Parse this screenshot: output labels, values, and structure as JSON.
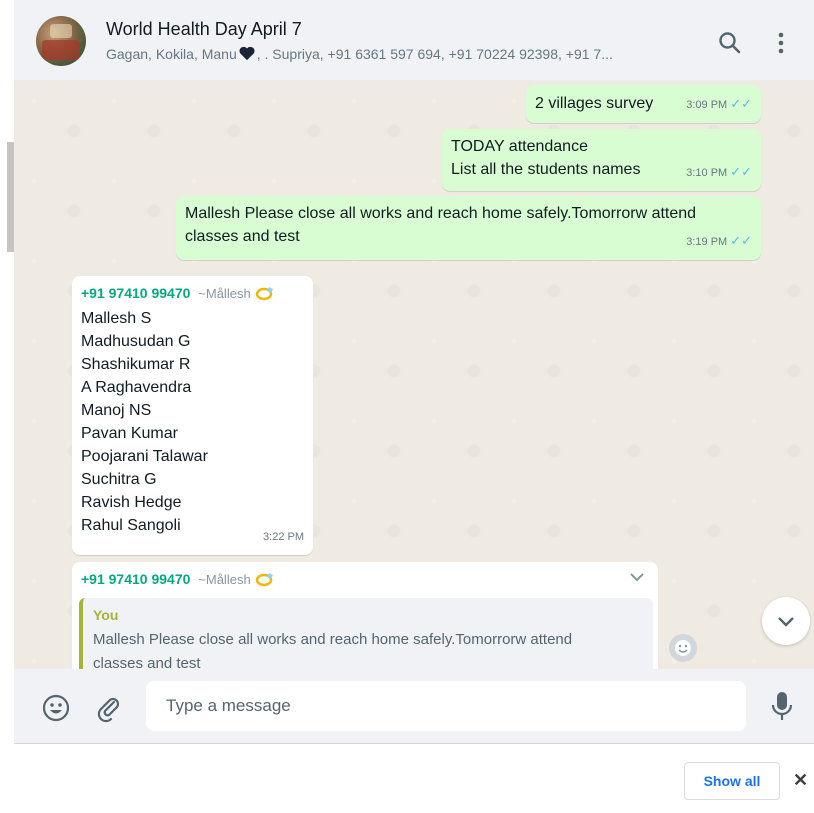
{
  "header": {
    "title": "World Health Day April 7",
    "members_before": "Gagan, Kokila, Manu",
    "members_after": ", . Supriya, +91 6361 597 694, +91 70224 92398, +91 7..."
  },
  "messages": [
    {
      "text": "2 villages survey",
      "time": "3:09 PM"
    },
    {
      "lines": [
        "TODAY attendance",
        "List all the students names"
      ],
      "time": "3:10 PM"
    },
    {
      "lines": [
        "Mallesh Please close all works and reach home safely.Tomorrorw attend",
        "classes and test"
      ],
      "time": "3:19 PM"
    },
    {
      "sender": "+91 97410 99470",
      "alias": "~Mållesh",
      "names": [
        "Mallesh S",
        "Madhusudan G",
        "Shashikumar R",
        "A Raghavendra",
        "Manoj NS",
        "Pavan Kumar",
        "Poojarani Talawar",
        "Suchitra G",
        "Ravish Hedge",
        "Rahul Sangoli"
      ],
      "time": "3:22 PM"
    },
    {
      "sender": "+91 97410 99470",
      "alias": "~Mållesh",
      "quote_author": "You",
      "quote_line1": "Mallesh Please close all works and reach home safely.Tomorrorw attend",
      "quote_line2": "classes and test"
    }
  ],
  "compose": {
    "placeholder": "Type a message"
  },
  "bottom_bar": {
    "show_all": "Show all",
    "close": "✕"
  },
  "colors": {
    "outgoing": "#d9fdd3",
    "incoming": "#ffffff",
    "sender": "#06a884",
    "ticks": "#53bdeb",
    "quote_bar": "#a5b337"
  }
}
